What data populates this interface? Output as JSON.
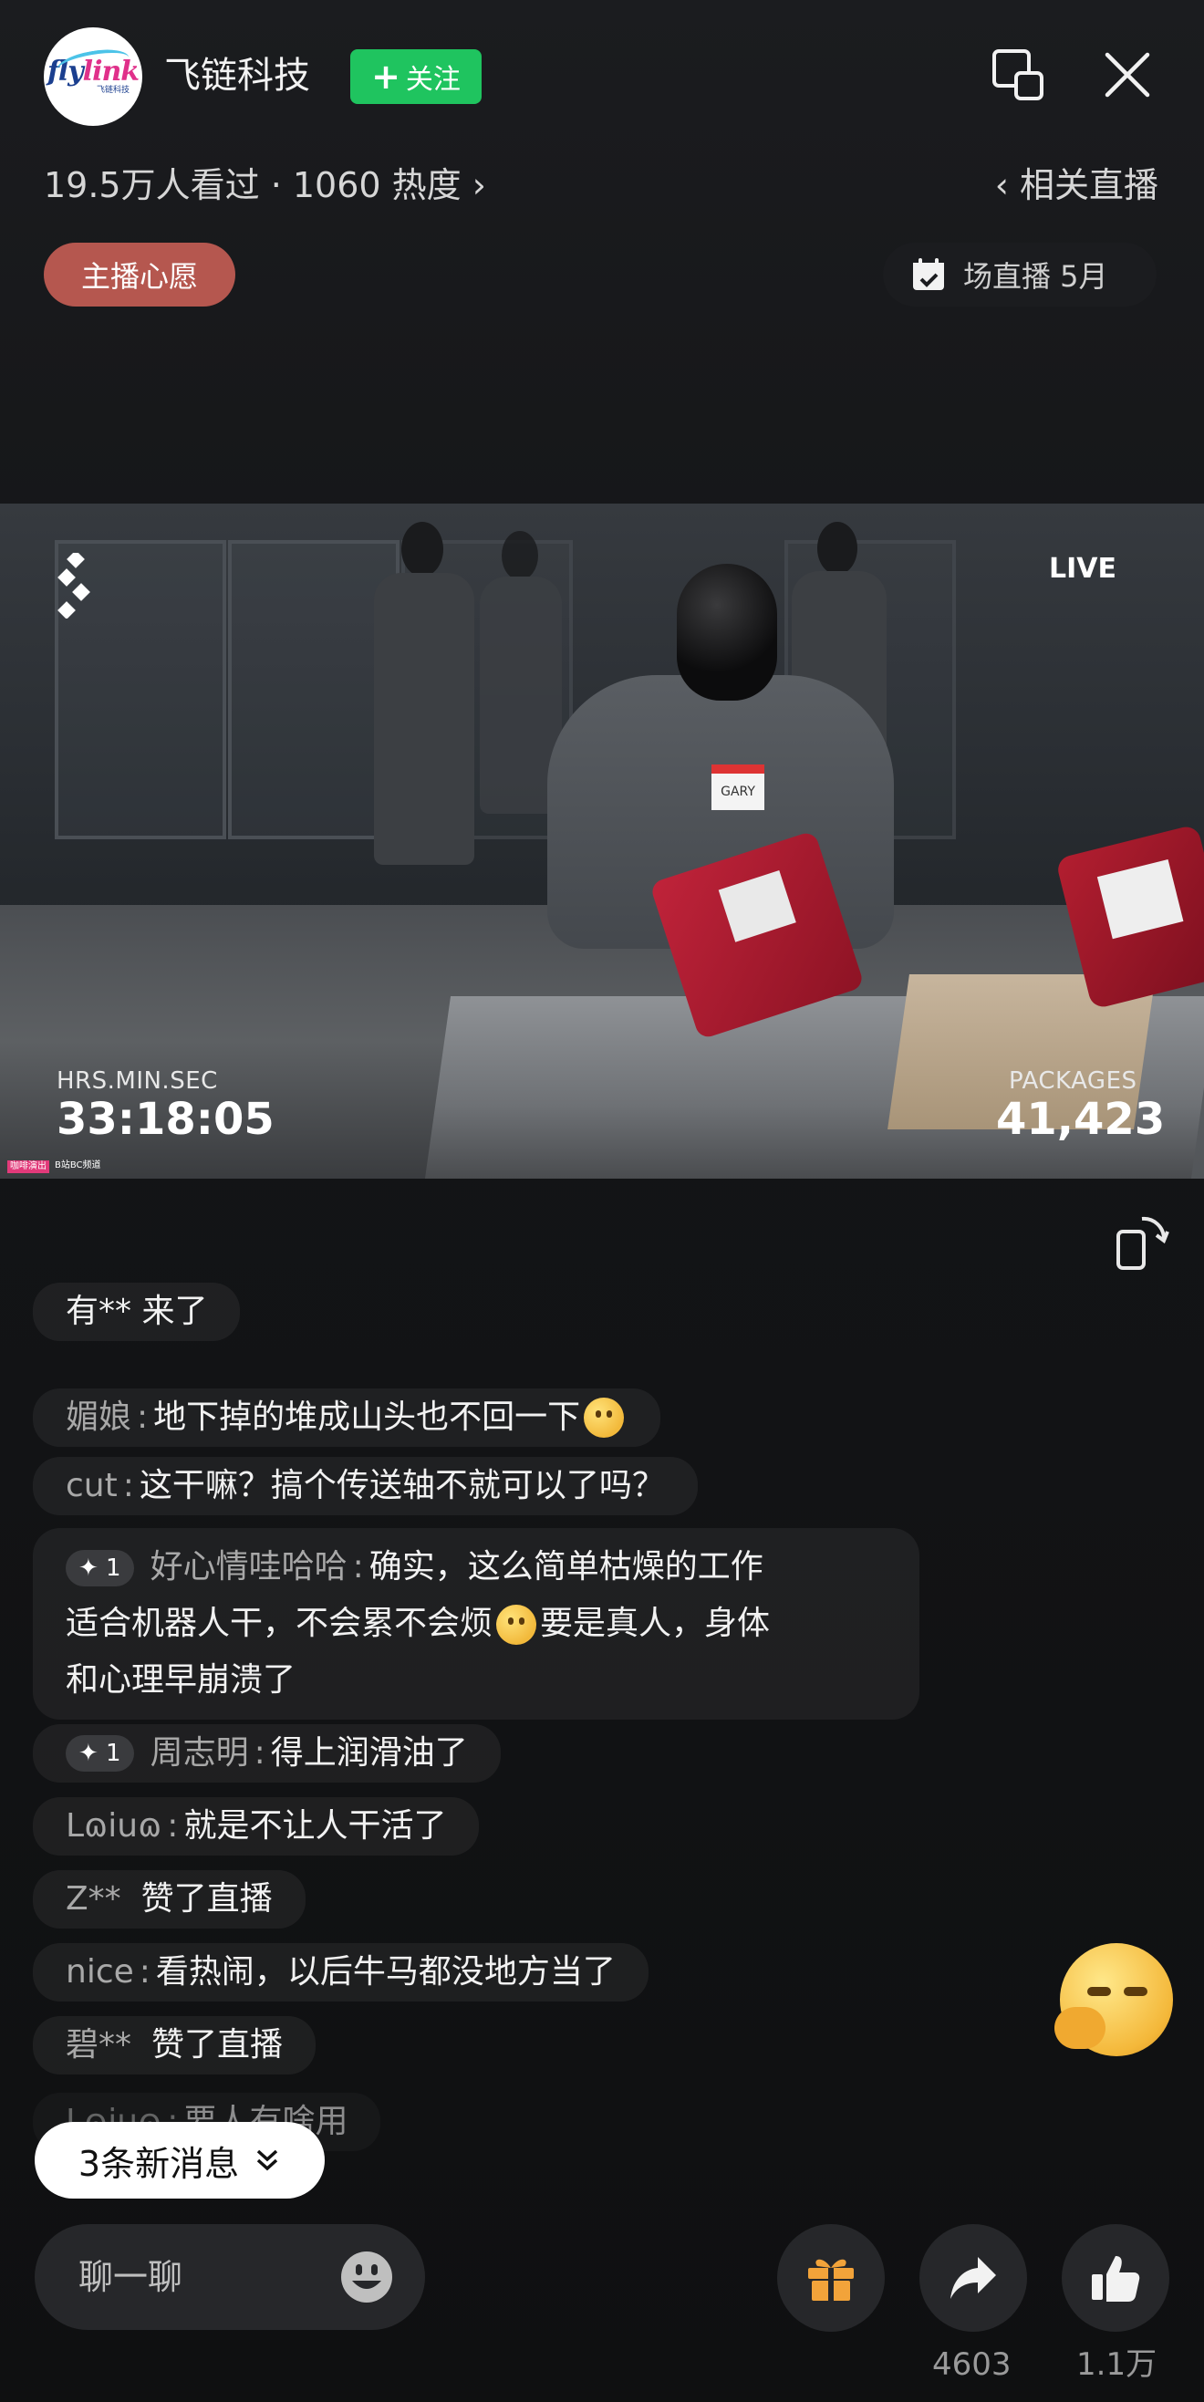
{
  "header": {
    "avatar_logo_main": "fly",
    "avatar_logo_accent": "link",
    "avatar_logo_sub": "飞链科技",
    "host_name": "飞链科技",
    "follow_label": "关注",
    "stats": "19.5万人看过 · 1060 热度 ›",
    "related_live": "‹ 相关直播",
    "wish_label": "主播心愿",
    "schedule_label": "场直播 5月"
  },
  "video": {
    "live_label": "LIVE",
    "time_label": "HRS.MIN.SEC",
    "time_value": "33:18:05",
    "packages_label": "PACKAGES",
    "packages_value": "41,423",
    "name_tag": "GARY",
    "tiny_left": "咖啡演出",
    "tiny_right": "B站BC频道"
  },
  "chat": {
    "entry_notice": "有** 来了",
    "messages": [
      {
        "user": "媚娘",
        "text": "地下掉的堆成山头也不回一下"
      },
      {
        "user": "cut",
        "text": "这干嘛？搞个传送轴不就可以了吗？"
      },
      {
        "badge": "✦ 1",
        "user": "好心情哇哈哈",
        "text_part1": "确实，这么简单枯燥的工作",
        "text_part2": "适合机器人干，不会累不会烦",
        "text_part3": "要是真人，身体",
        "text_part4": "和心理早崩溃了"
      },
      {
        "badge": "✦ 1",
        "user": "周志明",
        "text": "得上润滑油了"
      },
      {
        "user": "Lɷiuɷ",
        "text": "就是不让人干活了"
      },
      {
        "user": "Z**",
        "text": "赞了直播"
      },
      {
        "user": "nice",
        "text": "看热闹，以后牛马都没地方当了"
      },
      {
        "user": "碧**",
        "text": "赞了直播"
      },
      {
        "user": "Lɷiuɷ",
        "text": "要人有啥用"
      }
    ],
    "new_messages": "3条新消息"
  },
  "bottom": {
    "input_placeholder": "聊一聊",
    "share_count": "4603",
    "like_count": "1.1万"
  },
  "colors": {
    "follow_green": "#1fc45f",
    "wish_red": "#b5574f",
    "gift_orange": "#f2a33a"
  },
  "icons": [
    "window-icon",
    "close-icon",
    "calendar-icon",
    "rotate-screen-icon",
    "smile-icon",
    "gift-icon",
    "share-icon",
    "thumbs-up-icon",
    "chevron-down-icon"
  ]
}
